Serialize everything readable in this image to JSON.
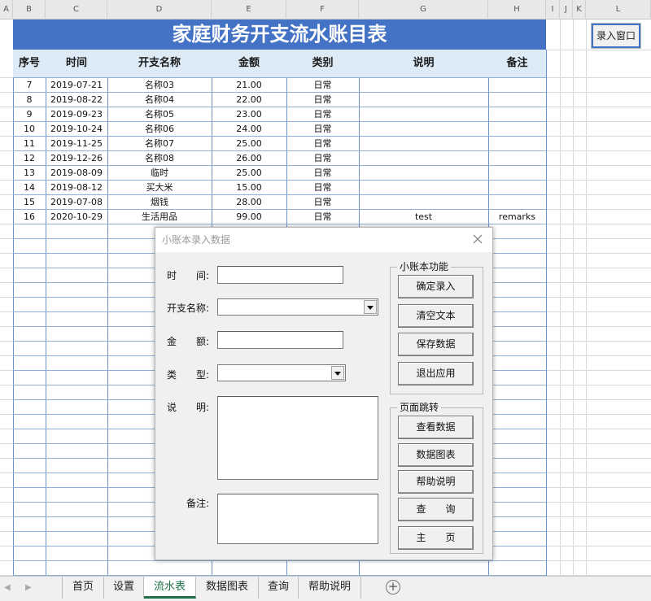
{
  "columns": [
    "A",
    "B",
    "C",
    "D",
    "E",
    "F",
    "G",
    "H",
    "I",
    "J",
    "K",
    "L"
  ],
  "sheet": {
    "title": "家庭财务开支流水账目表",
    "headers": [
      "序号",
      "时间",
      "开支名称",
      "金额",
      "类别",
      "说明",
      "备注"
    ],
    "rows": [
      [
        "7",
        "2019-07-21",
        "名称03",
        "21.00",
        "日常",
        "",
        ""
      ],
      [
        "8",
        "2019-08-22",
        "名称04",
        "22.00",
        "日常",
        "",
        ""
      ],
      [
        "9",
        "2019-09-23",
        "名称05",
        "23.00",
        "日常",
        "",
        ""
      ],
      [
        "10",
        "2019-10-24",
        "名称06",
        "24.00",
        "日常",
        "",
        ""
      ],
      [
        "11",
        "2019-11-25",
        "名称07",
        "25.00",
        "日常",
        "",
        ""
      ],
      [
        "12",
        "2019-12-26",
        "名称08",
        "26.00",
        "日常",
        "",
        ""
      ],
      [
        "13",
        "2019-08-09",
        "临时",
        "25.00",
        "日常",
        "",
        ""
      ],
      [
        "14",
        "2019-08-12",
        "买大米",
        "15.00",
        "日常",
        "",
        ""
      ],
      [
        "15",
        "2019-07-08",
        "烟钱",
        "28.00",
        "日常",
        "",
        ""
      ],
      [
        "16",
        "2020-10-29",
        "生活用品",
        "99.00",
        "日常",
        "test",
        "remarks"
      ]
    ],
    "entry_button": "录入窗口"
  },
  "dialog": {
    "title": "小账本录入数据",
    "labels": {
      "time": "时　　间:",
      "name": "开支名称:",
      "amount": "金　　额:",
      "type": "类　　型:",
      "desc": "说　　明:",
      "remark": "备注:"
    },
    "fields": {
      "time": "",
      "name": "",
      "amount": "",
      "type": "",
      "desc": "",
      "remark": ""
    },
    "group_functions": {
      "title": "小账本功能",
      "buttons": [
        "确定录入",
        "清空文本",
        "保存数据",
        "退出应用"
      ]
    },
    "group_pages": {
      "title": "页面跳转",
      "buttons": [
        "查看数据",
        "数据图表",
        "帮助说明",
        "查　　询",
        "主　　页"
      ]
    }
  },
  "tabs": [
    {
      "label": "首页",
      "active": false
    },
    {
      "label": "设置",
      "active": false
    },
    {
      "label": "流水表",
      "active": true
    },
    {
      "label": "数据图表",
      "active": false
    },
    {
      "label": "查询",
      "active": false
    },
    {
      "label": "帮助说明",
      "active": false
    }
  ],
  "colors": {
    "title_bg": "#4472c4",
    "header_bg": "#ddebf7",
    "active_tab": "#1e7145"
  }
}
